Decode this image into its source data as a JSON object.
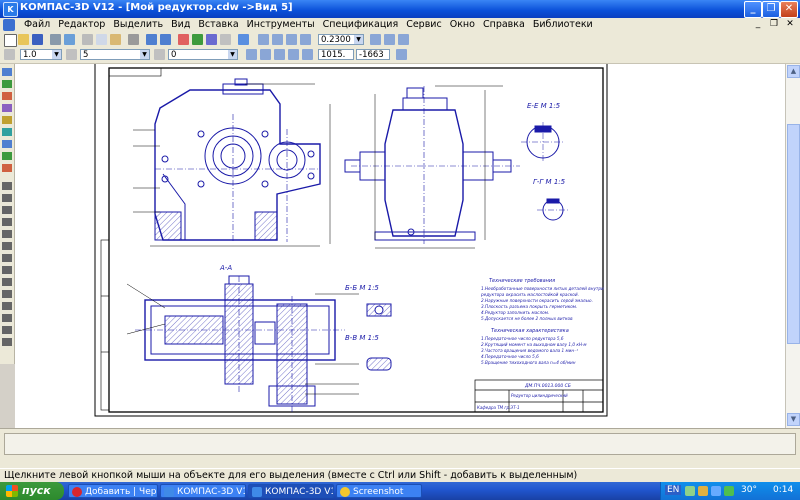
{
  "window": {
    "title": "КОМПАС-3D V12 - [Мой редуктор.cdw ->Вид 5]",
    "app_icon": "K"
  },
  "menu": {
    "items": [
      "Файл",
      "Редактор",
      "Выделить",
      "Вид",
      "Вставка",
      "Инструменты",
      "Спецификация",
      "Сервис",
      "Окно",
      "Справка",
      "Библиотеки"
    ]
  },
  "toolbar": {
    "zoom_value": "0.2300",
    "coord_x": "1015.",
    "coord_y": "-1663"
  },
  "property_bar": {
    "line_scale": "1.0",
    "style_value": "5",
    "layer_value": "0"
  },
  "drawing": {
    "view_a_title": "А-А",
    "section_e_title": "Е-Е М 1:5",
    "section_g_title": "Г-Г М 1:5",
    "section_b_title": "Б-Б М 1:5",
    "section_v_title": "В-В М 1:5",
    "notes_title": "Технические требования",
    "notes_lines": [
      "1.Необработанные поверхности литых деталей внутри",
      "  редуктора окрасить маслостойкой краской.",
      "2.Наружные поверхности окрасить серой эмалью.",
      "3.Плоскость разъема покрыть герметиком.",
      "4.Редуктор заполнить маслом.",
      "5.Допускается не более 2 полных витков"
    ],
    "spec_title": "Техническая характеристика",
    "spec_lines": [
      "1.Передаточное число редуктора 5,6",
      "2.Крутящий момент на выходном валу 1,0 кН·м",
      "3.Частота вращения ведомого вала 1 мин⁻¹",
      "4.Передаточное число 5,6",
      "5.Вращение тихоходного вала n=4 об/мин"
    ],
    "stamp_code": "ДМ.ПЧ.0013.000 СБ",
    "stamp_name": "Редуктор цилиндрический",
    "stamp_org": "Кафедра ТМ гр.ЭТ-1"
  },
  "status": {
    "hint": "Щелкните левой кнопкой мыши на объекте для его выделения (вместе с Ctrl или Shift - добавить к выделенным)"
  },
  "taskbar": {
    "start_label": "пуск",
    "tasks": [
      "Добавить | Чер...",
      "КОМПАС-3D V12",
      "КОМПАС-3D V1...",
      "Screenshot"
    ],
    "language": "EN",
    "temperature": "30°",
    "clock": "0:14"
  },
  "colors": {
    "drawing_line": "#1a1aa8",
    "title_bar": "#0a4fd8",
    "taskbar": "#2157d0"
  }
}
